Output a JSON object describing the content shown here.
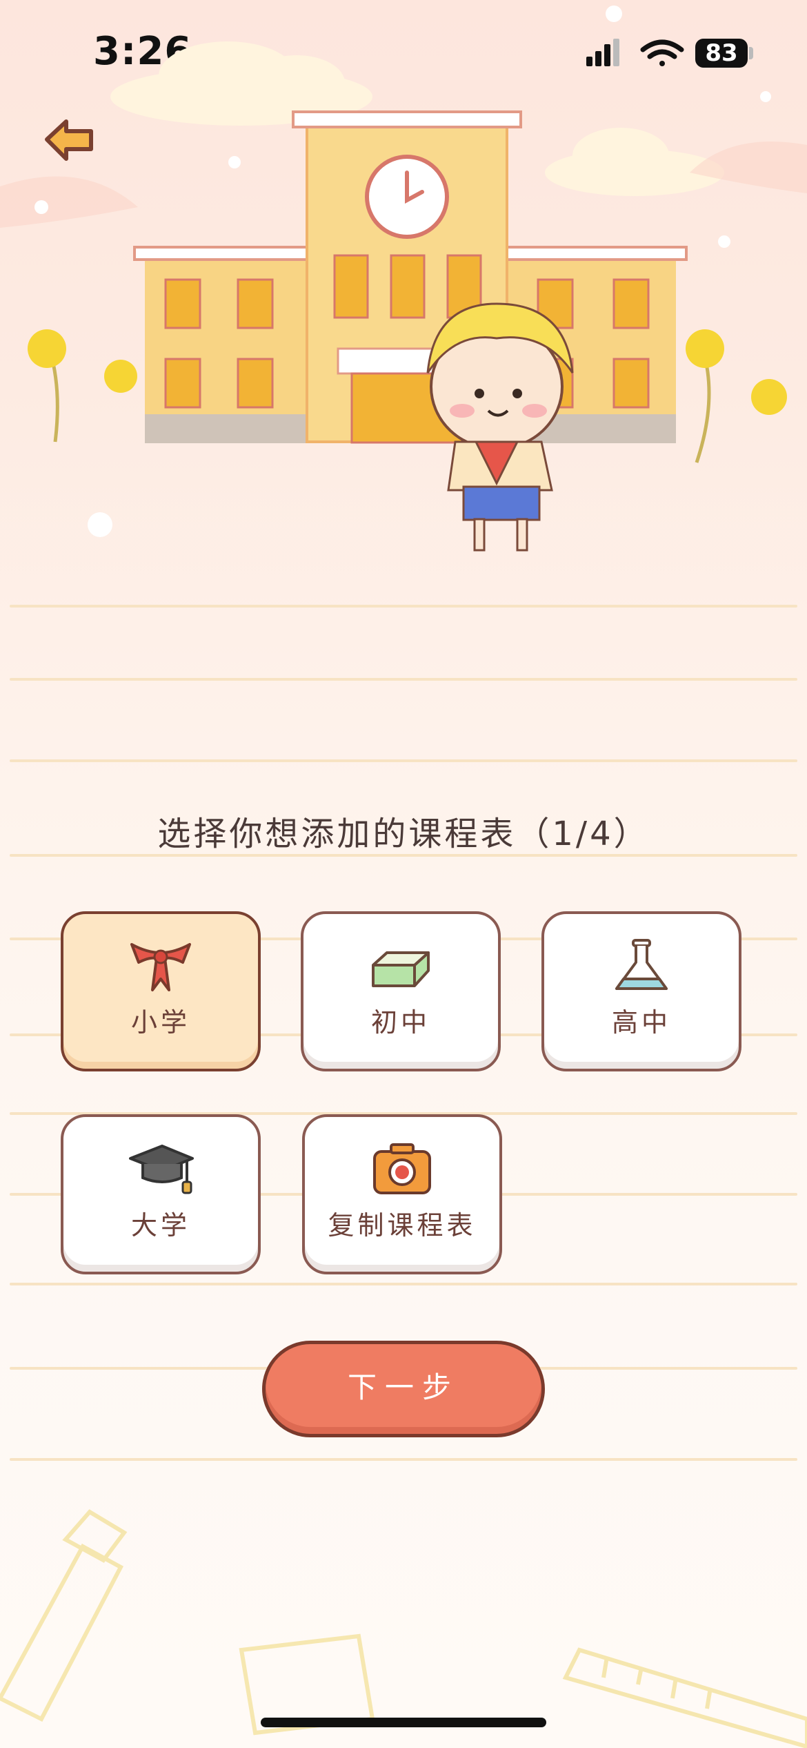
{
  "status_bar": {
    "time": "3:26",
    "battery": "83"
  },
  "nav": {
    "back_icon": "back-arrow-icon"
  },
  "title": "选择你想添加的课程表（1/4）",
  "options": [
    {
      "label": "小学",
      "icon": "red-scarf-icon",
      "selected": true
    },
    {
      "label": "初中",
      "icon": "eraser-icon",
      "selected": false
    },
    {
      "label": "高中",
      "icon": "flask-icon",
      "selected": false
    },
    {
      "label": "大学",
      "icon": "graduation-cap-icon",
      "selected": false
    },
    {
      "label": "复制课程表",
      "icon": "camera-icon",
      "selected": false
    }
  ],
  "next_button": "下一步",
  "colors": {
    "accent": "#ef7c62",
    "selected_bg": "#fde6c4",
    "border": "#8a5a52"
  }
}
